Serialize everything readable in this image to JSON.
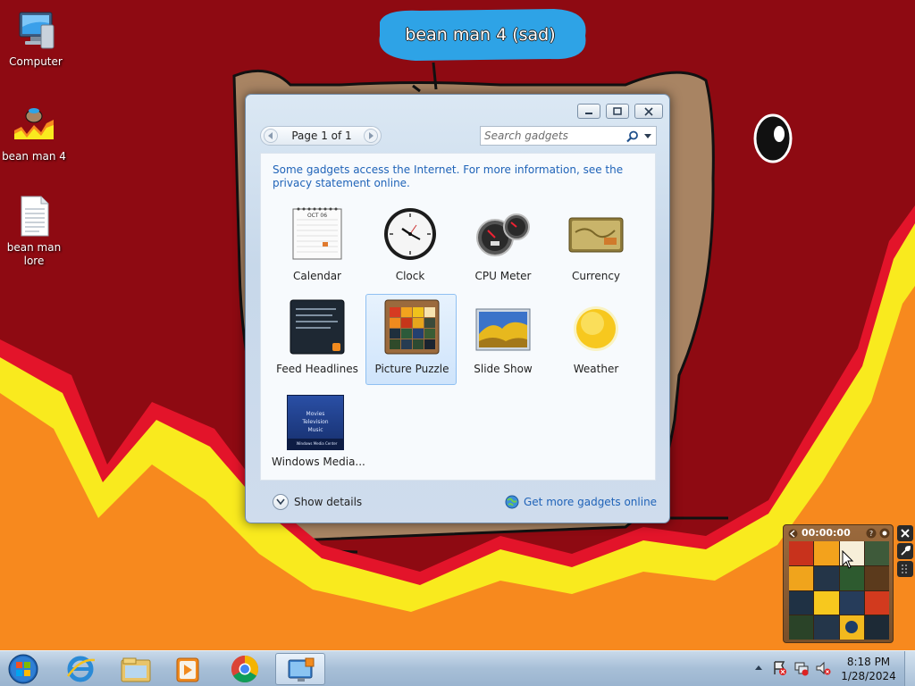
{
  "desktop": {
    "wallpaper_text": "bean man 4 (sad)",
    "icons": [
      {
        "label": "Computer",
        "icon": "computer-icon"
      },
      {
        "label": "bean man 4",
        "icon": "bean-man-image-icon"
      },
      {
        "label": "bean man\nlore",
        "icon": "text-document-icon"
      }
    ]
  },
  "gadget_window": {
    "pager": {
      "label": "Page 1 of 1"
    },
    "search": {
      "placeholder": "Search gadgets"
    },
    "info_text": "Some gadgets access the Internet.  For more information, see the privacy statement online.",
    "gadgets": [
      {
        "label": "Calendar",
        "icon": "calendar-gadget-icon",
        "thumb_text": "OCT 06"
      },
      {
        "label": "Clock",
        "icon": "clock-gadget-icon"
      },
      {
        "label": "CPU Meter",
        "icon": "cpu-meter-gadget-icon"
      },
      {
        "label": "Currency",
        "icon": "currency-gadget-icon"
      },
      {
        "label": "Feed Headlines",
        "icon": "feed-headlines-gadget-icon"
      },
      {
        "label": "Picture Puzzle",
        "icon": "picture-puzzle-gadget-icon",
        "selected": true
      },
      {
        "label": "Slide Show",
        "icon": "slide-show-gadget-icon"
      },
      {
        "label": "Weather",
        "icon": "weather-gadget-icon"
      },
      {
        "label": "Windows Media...",
        "icon": "windows-media-center-gadget-icon",
        "menu": [
          "Movies",
          "Television",
          "Music"
        ],
        "footer": "Windows Media Center"
      }
    ],
    "show_details": "Show details",
    "get_more": "Get more gadgets online"
  },
  "puzzle_gadget": {
    "timer": "00:00:00"
  },
  "taskbar": {
    "pinned": [
      "start-orb-icon",
      "internet-explorer-icon",
      "file-explorer-icon",
      "windows-media-player-icon",
      "chrome-icon",
      "gadgets-window-icon"
    ],
    "clock": {
      "time": "8:18 PM",
      "date": "1/28/2024"
    }
  },
  "colors": {
    "wallpaper_red": "#8e0a12",
    "flame_orange": "#f7891e",
    "flame_yellow": "#f9ea1e",
    "link_blue": "#1f63b8",
    "selection": "#cfe4fb"
  }
}
